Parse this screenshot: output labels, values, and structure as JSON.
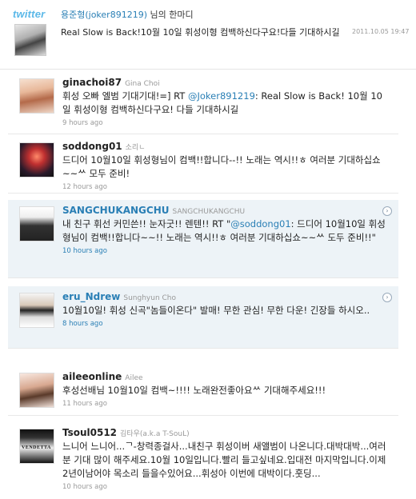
{
  "header": {
    "logo": "twitter",
    "author": "용준형(joker891219)",
    "suffix": " 님의 한마디",
    "text": "Real Slow is Back!10월 10일 휘성이형 컴백하신다구요!다들 기대하시길",
    "date": "2011.10.05 19:47"
  },
  "tweets": [
    {
      "username": "ginachoi87",
      "fullname": "Gina Choi",
      "text_before": "휘성 오빠 엘범 기대기대!=] RT ",
      "mention": "@Joker891219",
      "text_after": ": Real Slow is Back! 10월 10일 휘성이형 컴백하신다구요! 다들 기대하시길",
      "time": "9 hours ago"
    },
    {
      "username": "soddong01",
      "fullname": "소리ㄴ",
      "text": "드디어 10월10일 휘성형님이 컴백!!합니다--!! 노래는 역시!!ㅎ 여러분 기대하십쇼~~ᄊ 모두 준비!",
      "time": "12 hours ago"
    },
    {
      "username": "SANGCHUKANGCHU",
      "fullname": "SANGCHUKANGCHU",
      "text_before": "내 친구 휘선 커민쓴!! 눈자굿!! 렌텐!! RT \"",
      "mention": "@soddong01",
      "text_after": ": 드디어 10월10일 휘성형님이 컴백!!합니다~~!! 노래는 역시!!ㅎ 여러분 기대하십쇼~~ᄊ 도두 준비!!\"",
      "time": "10 hours ago"
    },
    {
      "username": "eru_Ndrew",
      "fullname": "Sunghyun Cho",
      "text": "10월10일! 휘성 신곡\"놈들이온다\" 발매! 무한 관심! 무한 다운! 긴장들 하시오..",
      "time": "8 hours ago"
    },
    {
      "username": "aileeonline",
      "fullname": "Ailee",
      "text": "후성선배님 10월10일 컴백~!!!! 노래완전좋아요ᄊ 기대해주세요!!!",
      "time": "11 hours ago"
    },
    {
      "username": "Tsoul0512",
      "fullname": "김타우(a.k.a T-SouL)",
      "text": "느니어 느니어...ᄀ-창력종걸사...내친구 휘성이버 새앨범이 나온니다.대박대박...여러분 기대 많이 해주세요.10월 10일입니다.빨리 들고싶네요.입대전 마지막입니다.이제 2년이남어야 목소리 들을수있어요...휘성아 이번에 대박이다.훗딩...",
      "time": "10 hours ago",
      "avatar_label": "VENDETTA"
    }
  ]
}
